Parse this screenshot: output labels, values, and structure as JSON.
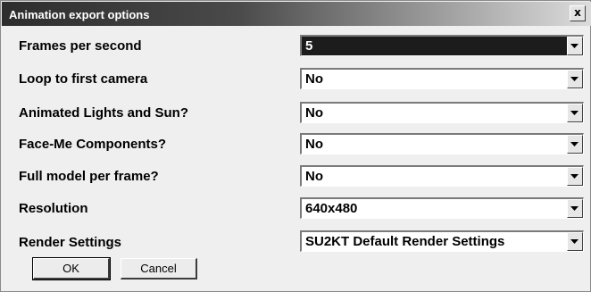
{
  "window": {
    "title": "Animation export options",
    "close_label": "x"
  },
  "rows": [
    {
      "label": "Frames per second",
      "value": "5"
    },
    {
      "label": "Loop to first camera",
      "value": "No"
    },
    {
      "label": "Animated Lights and Sun?",
      "value": "No"
    },
    {
      "label": "Face-Me Components?",
      "value": "No"
    },
    {
      "label": "Full model per frame?",
      "value": "No"
    },
    {
      "label": "Resolution",
      "value": "640x480"
    },
    {
      "label": "Render Settings",
      "value": "SU2KT Default Render Settings"
    }
  ],
  "buttons": {
    "ok_label": "OK",
    "cancel_label": "Cancel"
  }
}
